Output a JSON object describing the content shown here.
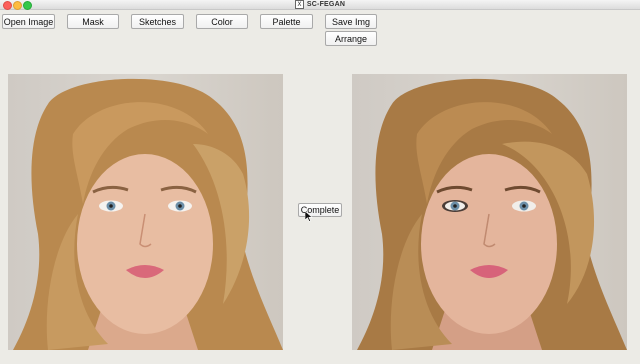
{
  "window": {
    "title": "SC-FEGAN"
  },
  "toolbar": {
    "open_image": "Open Image",
    "mask": "Mask",
    "sketches": "Sketches",
    "color": "Color",
    "palette": "Palette",
    "save_img": "Save Img",
    "arrange": "Arrange"
  },
  "main": {
    "complete": "Complete"
  },
  "icons": {
    "app_icon": "x11-icon",
    "cursor": "mouse-pointer-icon"
  },
  "colors": {
    "background": "#ecebe6",
    "close": "#fc605c",
    "minimize": "#fdbc40",
    "maximize": "#34c84a"
  }
}
